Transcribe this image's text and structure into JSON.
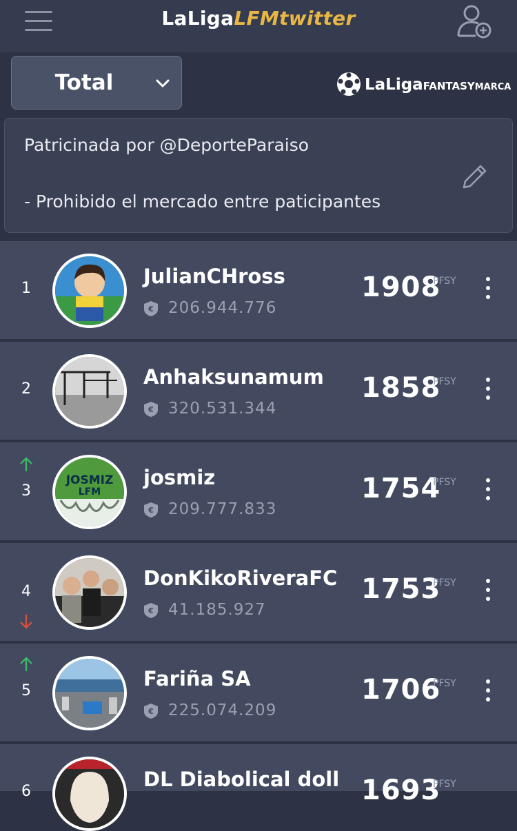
{
  "header": {
    "title_main": "LaLiga",
    "title_accent": "LFMtwitter",
    "menu_icon": "hamburger-icon",
    "add_user_icon": "add-user-icon"
  },
  "filter": {
    "label": "Total",
    "icon": "chevron-down-icon"
  },
  "brand": {
    "logo_text": "LaLiga",
    "logo_sub": "FANTASY",
    "logo_sub2": "MARCA"
  },
  "notice": {
    "line1": "Patricinada por @DeporteParaiso",
    "line2": "- Prohibido el mercado entre paticipantes",
    "edit_icon": "pencil-icon"
  },
  "ranking": [
    {
      "rank": "1",
      "trend": "",
      "name": "JulianCHross",
      "value": "206.944.776",
      "points": "1908",
      "unit": "PFSY"
    },
    {
      "rank": "2",
      "trend": "",
      "name": "Anhaksunamum",
      "value": "320.531.344",
      "points": "1858",
      "unit": "PFSY"
    },
    {
      "rank": "3",
      "trend": "up",
      "name": "josmiz",
      "value": "209.777.833",
      "points": "1754",
      "unit": "PFSY",
      "avatar_text": "JOSMIZ LFM"
    },
    {
      "rank": "4",
      "trend": "down",
      "name": "DonKikoRiveraFC",
      "value": "41.185.927",
      "points": "1753",
      "unit": "PFSY"
    },
    {
      "rank": "5",
      "trend": "up",
      "name": "Fariña SA",
      "value": "225.074.209",
      "points": "1706",
      "unit": "PFSY"
    },
    {
      "rank": "6",
      "trend": "",
      "name": "DL Diabolical doll",
      "value": "",
      "points": "1693",
      "unit": "PFSY"
    }
  ],
  "colors": {
    "accent": "#e8b645",
    "up": "#3bbf6a",
    "down": "#e0503c",
    "row": "#434a60",
    "background": "#2d3344"
  }
}
